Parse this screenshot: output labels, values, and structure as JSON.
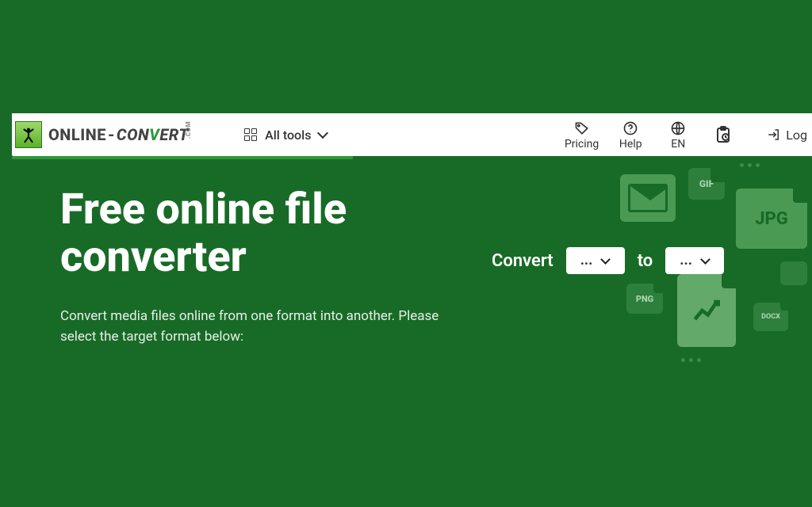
{
  "logo": {
    "online": "ONLINE",
    "dash": "-",
    "con": "CON",
    "v": "V",
    "ert": "ERT",
    "com": ".COM"
  },
  "nav": {
    "alltools": "All tools",
    "pricing": "Pricing",
    "help": "Help",
    "lang": "EN",
    "login": "Log"
  },
  "hero": {
    "title": "Free online file converter",
    "subtitle": "Convert media files online from one format into another. Please select the target format below:"
  },
  "convert": {
    "label_convert": "Convert",
    "label_to": "to",
    "from_value": "...",
    "to_value": "..."
  },
  "deco_labels": {
    "gif": "GIF",
    "jpg": "JPG",
    "png": "PNG",
    "docx": "DOCX"
  }
}
